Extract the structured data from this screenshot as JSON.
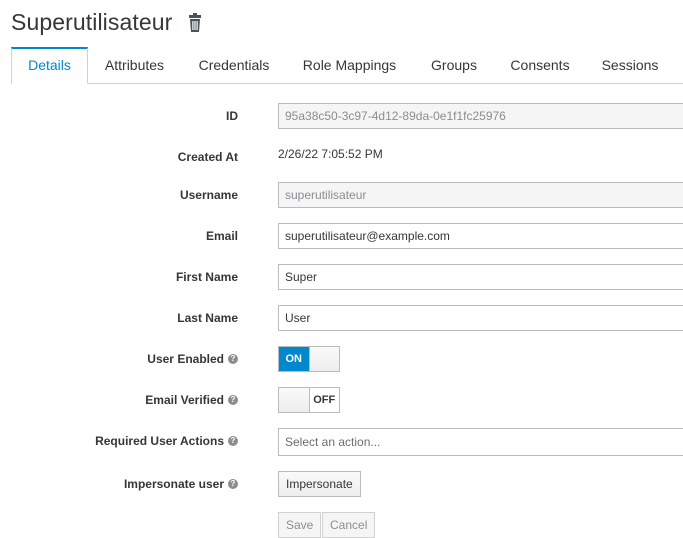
{
  "header": {
    "title": "Superutilisateur"
  },
  "tabs": [
    "Details",
    "Attributes",
    "Credentials",
    "Role Mappings",
    "Groups",
    "Consents",
    "Sessions"
  ],
  "form": {
    "id_label": "ID",
    "id_value": "95a38c50-3c97-4d12-89da-0e1f1fc25976",
    "created_label": "Created At",
    "created_value": "2/26/22 7:05:52 PM",
    "username_label": "Username",
    "username_value": "superutilisateur",
    "email_label": "Email",
    "email_value": "superutilisateur@example.com",
    "first_name_label": "First Name",
    "first_name_value": "Super",
    "last_name_label": "Last Name",
    "last_name_value": "User",
    "user_enabled_label": "User Enabled",
    "user_enabled_state": "ON",
    "email_verified_label": "Email Verified",
    "email_verified_state": "OFF",
    "required_actions_label": "Required User Actions",
    "required_actions_placeholder": "Select an action...",
    "impersonate_label": "Impersonate user",
    "impersonate_button": "Impersonate",
    "save_button": "Save",
    "cancel_button": "Cancel"
  },
  "colors": {
    "accent": "#0088ce",
    "text": "#363636",
    "muted": "#8b8d8f",
    "border": "#bbbbbb"
  },
  "icons": {
    "delete": "trash-icon",
    "help": "help-icon"
  }
}
